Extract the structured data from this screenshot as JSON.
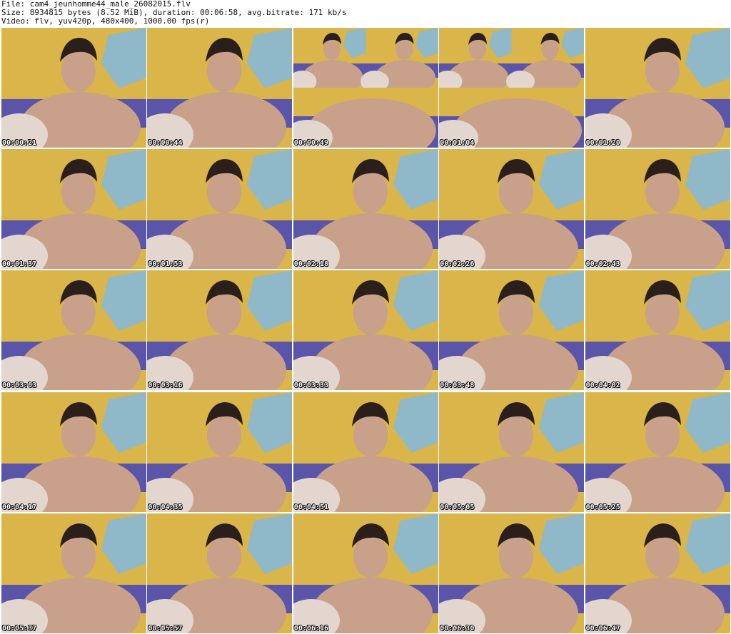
{
  "header": {
    "file_line": "File: cam4_jeunhomme44_male_26082015.flv",
    "size_line": "Size: 8934815 bytes (8.52 MiB), duration: 00:06:58, avg.bitrate: 171 kb/s",
    "video_line": "Video: flv, yuv420p, 480x400, 1000.00 fps(r)"
  },
  "thumbnails": [
    {
      "timestamp": "00:00:21",
      "split": false
    },
    {
      "timestamp": "00:00:44",
      "split": false
    },
    {
      "timestamp": "00:00:49",
      "split": true
    },
    {
      "timestamp": "00:01:04",
      "split": true
    },
    {
      "timestamp": "00:01:20",
      "split": false
    },
    {
      "timestamp": "00:01:37",
      "split": false
    },
    {
      "timestamp": "00:01:53",
      "split": false
    },
    {
      "timestamp": "00:02:18",
      "split": false
    },
    {
      "timestamp": "00:02:26",
      "split": false
    },
    {
      "timestamp": "00:02:43",
      "split": false
    },
    {
      "timestamp": "00:03:03",
      "split": false
    },
    {
      "timestamp": "00:03:16",
      "split": false
    },
    {
      "timestamp": "00:03:33",
      "split": false
    },
    {
      "timestamp": "00:03:48",
      "split": false
    },
    {
      "timestamp": "00:04:02",
      "split": false
    },
    {
      "timestamp": "00:04:17",
      "split": false
    },
    {
      "timestamp": "00:04:35",
      "split": false
    },
    {
      "timestamp": "00:04:51",
      "split": false
    },
    {
      "timestamp": "00:05:05",
      "split": false
    },
    {
      "timestamp": "00:05:25",
      "split": false
    },
    {
      "timestamp": "00:05:37",
      "split": false
    },
    {
      "timestamp": "00:05:57",
      "split": false
    },
    {
      "timestamp": "00:06:16",
      "split": false
    },
    {
      "timestamp": "00:06:30",
      "split": false
    },
    {
      "timestamp": "00:06:47",
      "split": false
    }
  ],
  "colors": {
    "wall": "#d9b54a",
    "map": "#8fb8c8",
    "skin": "#c9a089",
    "hair": "#2a1f1a",
    "blanket": "#5a55a8",
    "knee": "#e2d6cf"
  }
}
